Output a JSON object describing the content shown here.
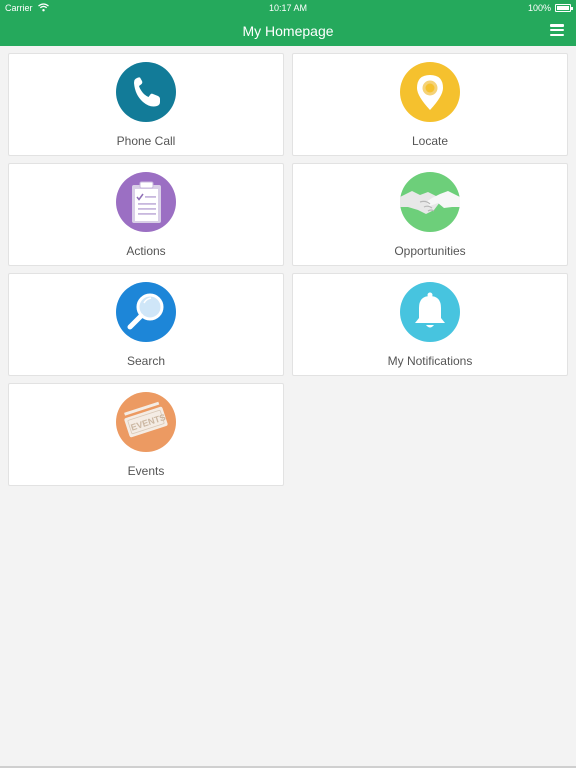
{
  "status_bar": {
    "carrier": "Carrier",
    "time": "10:17 AM",
    "battery": "100%"
  },
  "navbar": {
    "title": "My Homepage",
    "menu_icon": "hamburger-menu-icon"
  },
  "colors": {
    "brand": "#25a95c",
    "phone": "#127b98",
    "locate": "#f5c12e",
    "actions": "#9b6fc3",
    "opportunities": "#6dcf7a",
    "search": "#1d86d8",
    "notifications": "#47c4df",
    "events": "#ec9a62"
  },
  "tiles": [
    {
      "label": "Phone Call",
      "icon": "phone-icon"
    },
    {
      "label": "Locate",
      "icon": "location-pin-icon"
    },
    {
      "label": "Actions",
      "icon": "clipboard-checklist-icon"
    },
    {
      "label": "Opportunities",
      "icon": "handshake-icon"
    },
    {
      "label": "Search",
      "icon": "magnifier-icon"
    },
    {
      "label": "My Notifications",
      "icon": "bell-icon"
    },
    {
      "label": "Events",
      "icon": "event-ticket-icon"
    }
  ]
}
